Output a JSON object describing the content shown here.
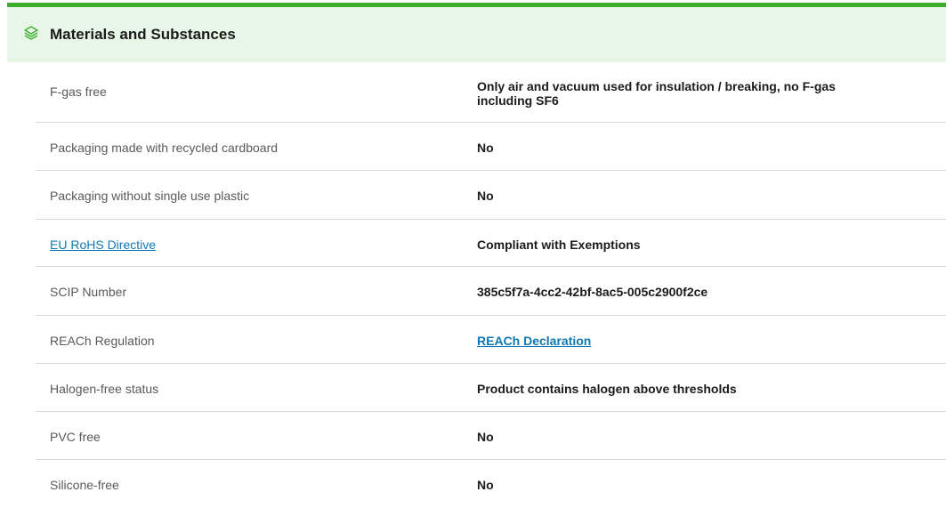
{
  "section": {
    "title": "Materials and Substances",
    "icon": "layers-icon",
    "accent_color": "#3dae2b",
    "header_bg": "#e7f6e6"
  },
  "rows": [
    {
      "label": "F-gas free",
      "value": "Only air and vacuum used for insulation / breaking, no F-gas including SF6"
    },
    {
      "label": "Packaging made with recycled cardboard",
      "value": "No"
    },
    {
      "label": "Packaging without single use plastic",
      "value": "No"
    },
    {
      "label": "EU RoHS Directive",
      "value": "Compliant with Exemptions"
    },
    {
      "label": "SCIP Number",
      "value": "385c5f7a-4cc2-42bf-8ac5-005c2900f2ce"
    },
    {
      "label": "REACh Regulation",
      "value": "REACh Declaration"
    },
    {
      "label": "Halogen-free status",
      "value": "Product contains halogen above thresholds"
    },
    {
      "label": "PVC free",
      "value": "No"
    },
    {
      "label": "Silicone-free",
      "value": "No"
    }
  ],
  "link_color": "#0f78b3"
}
